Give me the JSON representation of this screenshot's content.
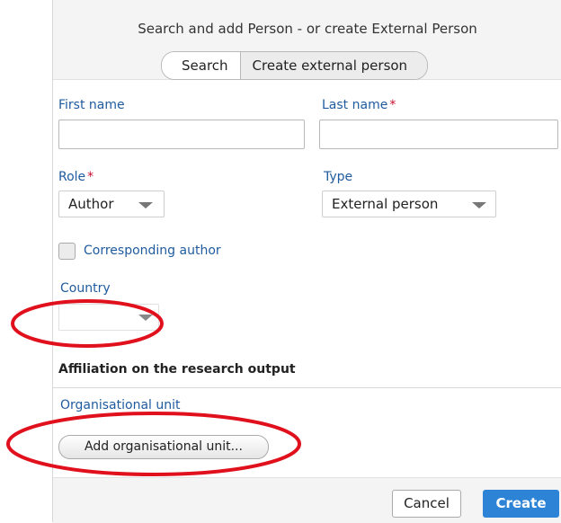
{
  "dialog": {
    "title": "Search and add Person - or create External Person",
    "tabs": [
      {
        "label": "Search"
      },
      {
        "label": "Create external person"
      }
    ]
  },
  "form": {
    "first_name": {
      "label": "First name",
      "value": "",
      "placeholder": ""
    },
    "last_name": {
      "label": "Last name",
      "required_marker": "*",
      "value": "",
      "placeholder": ""
    },
    "role": {
      "label": "Role",
      "required_marker": "*",
      "selected": "Author"
    },
    "type": {
      "label": "Type",
      "selected": "External person"
    },
    "corresponding_author": {
      "label": "Corresponding author",
      "checked": false
    },
    "country": {
      "label": "Country",
      "selected": ""
    }
  },
  "affiliation": {
    "title": "Affiliation on the research output",
    "org_unit_label": "Organisational unit",
    "add_button": "Add organisational unit..."
  },
  "footer": {
    "cancel": "Cancel",
    "create": "Create"
  },
  "colors": {
    "accent": "#2d83d6",
    "label_blue": "#1f5b9e",
    "required_red": "#c8102e",
    "annotation_red": "#e0101c"
  }
}
